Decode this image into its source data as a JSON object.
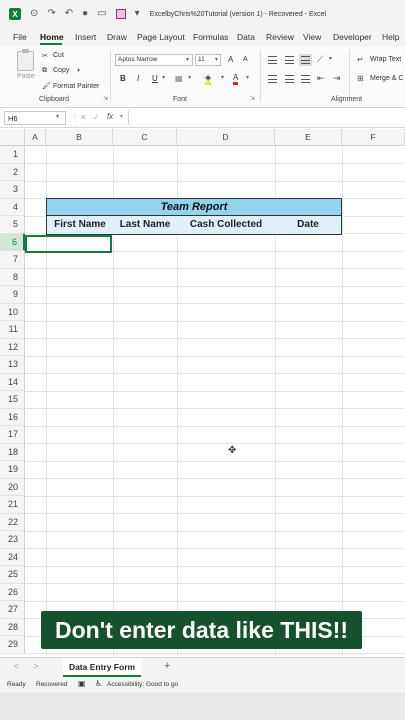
{
  "titlebar": {
    "app_icon": "X",
    "title": "ExcelbyChris%20Tutorial (version 1)  -  Recovered  -  Excel"
  },
  "menu": {
    "items": [
      "File",
      "Home",
      "Insert",
      "Draw",
      "Page Layout",
      "Formulas",
      "Data",
      "Review",
      "View",
      "Developer",
      "Help"
    ],
    "active": "Home"
  },
  "ribbon": {
    "clipboard": {
      "paste": "Paste",
      "cut": "Cut",
      "copy": "Copy",
      "format_painter": "Format Painter",
      "group": "Clipboard"
    },
    "font": {
      "name": "Aptos Narrow",
      "size": "11",
      "grow": "A",
      "shrink": "A",
      "bold": "B",
      "italic": "I",
      "underline": "U",
      "group": "Font"
    },
    "alignment": {
      "wrap_text": "Wrap Text",
      "merge": "Merge & C",
      "group": "Alignment"
    }
  },
  "formula_bar": {
    "name_box": "H6",
    "fx": "fx",
    "value": ""
  },
  "columns": [
    "A",
    "B",
    "C",
    "D",
    "E",
    "F"
  ],
  "rows": [
    "1",
    "2",
    "3",
    "4",
    "5",
    "6",
    "7",
    "8",
    "9",
    "10",
    "11",
    "12",
    "13",
    "14",
    "15",
    "16",
    "17",
    "18",
    "19",
    "20",
    "21",
    "22",
    "23",
    "24",
    "25",
    "26",
    "27",
    "28",
    "29"
  ],
  "selected_row": "6",
  "table": {
    "title": "Team Report",
    "headers": [
      "First Name",
      "Last Name",
      "Cash Collected",
      "Date"
    ],
    "title_color": "#92d3ee",
    "header_color": "#dff0f8"
  },
  "banner": {
    "text": "Don't enter data like THIS!!",
    "color": "#16502e"
  },
  "sheets": {
    "tabs": [
      "Data Entry Form"
    ],
    "active": "Data Entry Form"
  },
  "status": {
    "ready": "Ready",
    "recovered": "Recovered",
    "accessibility": "Accessibility: Good to go"
  },
  "colors": {
    "accent": "#107c41"
  }
}
